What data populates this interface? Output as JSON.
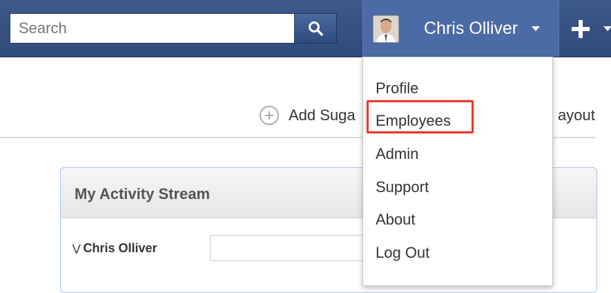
{
  "navbar": {
    "search": {
      "placeholder": "Search",
      "icon": "search-icon"
    },
    "user": {
      "name": "Chris Olliver",
      "avatar_icon": "avatar"
    },
    "quick_create_icon": "plus-icon"
  },
  "toolbar": {
    "add_dashlet_label": "Add Suga",
    "layout_label": "ayout"
  },
  "dashlet": {
    "title": "My Activity Stream",
    "stream_user": "Chris Olliver"
  },
  "user_dropdown": {
    "items": [
      "Profile",
      "Employees",
      "Admin",
      "Support",
      "About",
      "Log Out"
    ],
    "highlighted": "Employees"
  },
  "colors": {
    "navbar": "#2f4a7a",
    "user_menu_active": "#4c6aa6",
    "highlight": "#e8392a"
  }
}
